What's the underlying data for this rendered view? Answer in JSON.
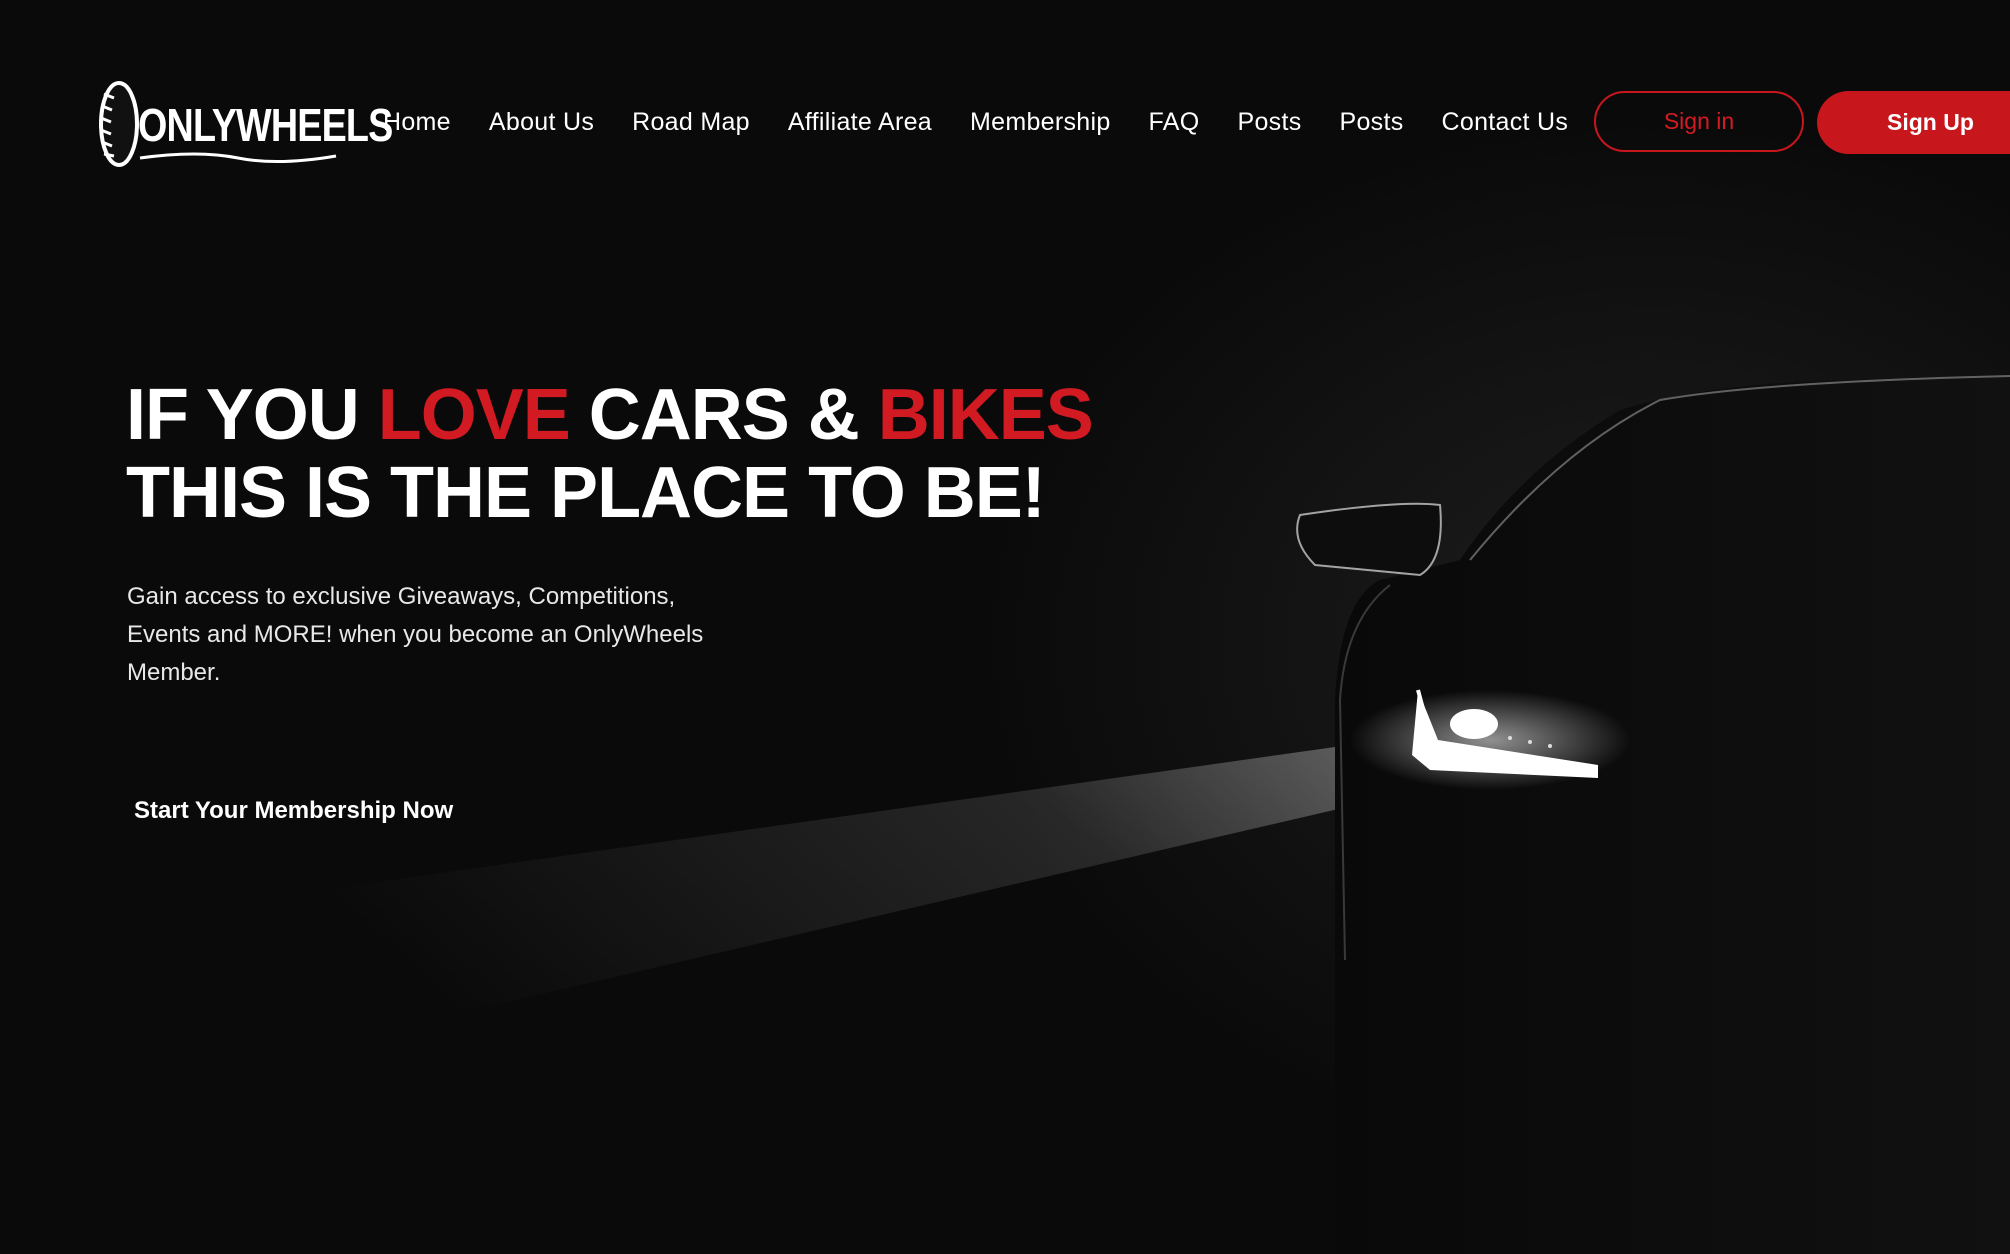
{
  "brand": {
    "logo_text": "ONLYWHEELS"
  },
  "nav": {
    "items": [
      {
        "label": "Home"
      },
      {
        "label": "About Us"
      },
      {
        "label": "Road Map"
      },
      {
        "label": "Affiliate Area"
      },
      {
        "label": "Membership"
      },
      {
        "label": "FAQ"
      },
      {
        "label": "Posts"
      },
      {
        "label": "Posts"
      },
      {
        "label": "Contact Us"
      }
    ],
    "sign_in_label": "Sign in",
    "sign_up_label": "Sign Up"
  },
  "hero": {
    "title_line1": {
      "part1": "IF YOU ",
      "part2_accent": "LOVE",
      "part3": " CARS & ",
      "part4_accent": "BIKES"
    },
    "title_line2": "THIS IS THE PLACE TO BE!",
    "description": "Gain access to exclusive Giveaways, Competitions, Events and MORE! when you become an OnlyWheels Member.",
    "cta_label": "Start Your Membership Now"
  },
  "colors": {
    "background": "#0b0b0b",
    "accent_red": "#c8161d",
    "text": "#ffffff"
  },
  "icons": {
    "logo_mark": "tire-icon"
  }
}
